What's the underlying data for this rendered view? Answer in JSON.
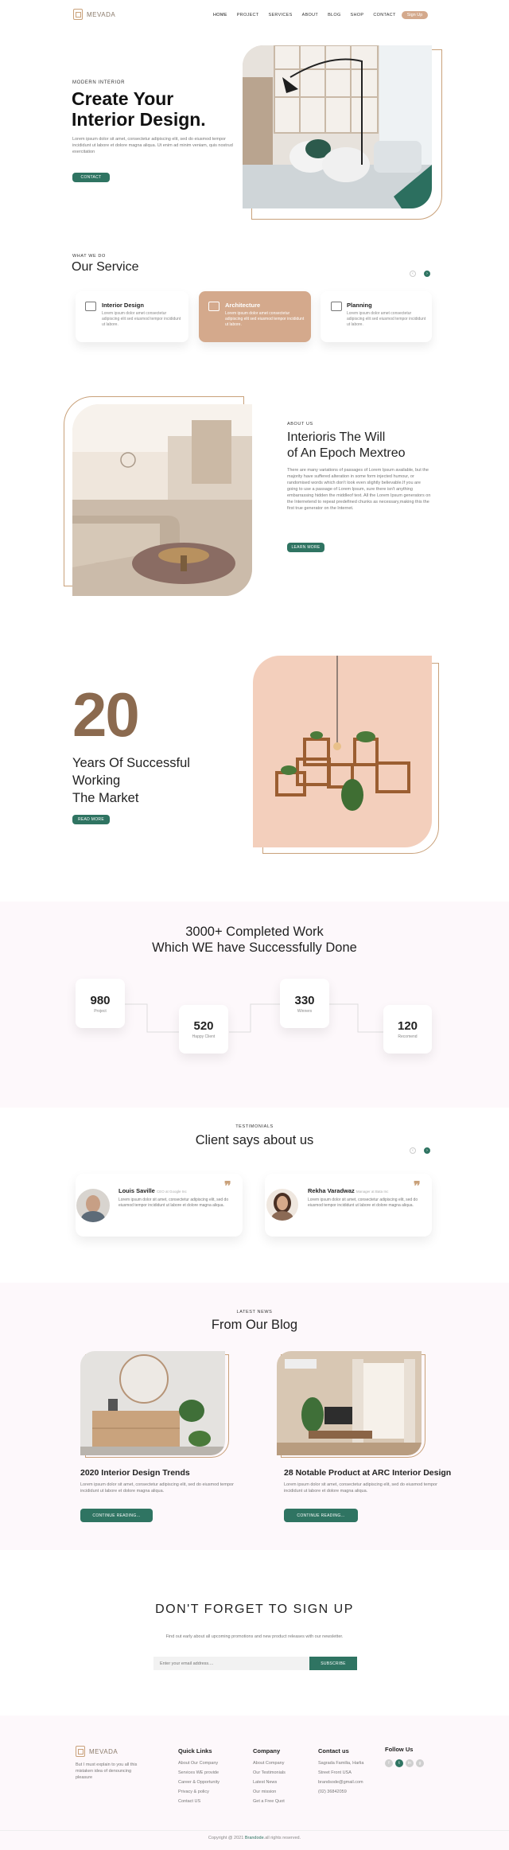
{
  "brand": {
    "name": "MEVADA"
  },
  "nav": {
    "items": [
      "HOME",
      "PROJECT",
      "SERVICES",
      "ABOUT",
      "BLOG",
      "SHOP",
      "CONTACT"
    ],
    "signup": "Sign Up"
  },
  "hero": {
    "kicker": "MODERN INTERIOR",
    "title_line1": "Create Your",
    "title_line2": "Interior Design.",
    "text": "Lorem ipsum dolor sit amet, consectetur adipiscing elit, sed do eiusmod tempor incididunt ut labore et dolore magna aliqua. Ut enim ad minim veniam, quis nostrud exercitation",
    "button": "CONTACT"
  },
  "services": {
    "kicker": "WHAT WE DO",
    "title": "Our Service",
    "items": [
      {
        "title": "Interior Design",
        "text": "Lorem ipsum dolor amet consectetur adipiscing elit sed eiusmod tempor incididunt ut labore."
      },
      {
        "title": "Architecture",
        "text": "Lorem ipsum dolor amet consectetur adipiscing elit sed eiusmod tempor incididunt ut labore."
      },
      {
        "title": "Planning",
        "text": "Lorem ipsum dolor amet consectetur adipiscing elit sed eiusmod tempor incididunt ut labore."
      }
    ]
  },
  "about": {
    "kicker": "ABOUT US",
    "title_line1": "Interioris The Will",
    "title_line2": "of An Epoch Mextreo",
    "text": "There are many variations of passages of Lorem Ipsum available, but the majority have suffered alteration in some form injected humour, or randomised words which don't look even slightly believable.If you are going to use a passage of Lorem Ipsum, sure there isn't anything embarrassing hidden the middleof text. All the Lorem Ipsum generators on the Internetend to repeat predefined chunks as necessary,making this the first true generator on the Internet.",
    "button": "LEARN MORE"
  },
  "years": {
    "number": "20",
    "line1": "Years Of Successful",
    "line2": "Working",
    "line3": "The Market",
    "button": "READ MORE"
  },
  "completed": {
    "title_line1": "3000+ Completed Work",
    "title_line2": "Which WE have Successfully Done",
    "stats": [
      {
        "value": "980",
        "label": "Project"
      },
      {
        "value": "520",
        "label": "Happy Client"
      },
      {
        "value": "330",
        "label": "Winners"
      },
      {
        "value": "120",
        "label": "Recomend"
      }
    ]
  },
  "testimonials": {
    "kicker": "TESTIMONIALS",
    "title": "Client says about us",
    "items": [
      {
        "name": "Louis Saville",
        "role": "CEO at Google Inc",
        "text": "Lorem ipsum dolor sit amet, consectetur adipiscing elit, sed do eiusmod tempor incididunt ut labore et dolore magna aliqua."
      },
      {
        "name": "Rekha Varadwaz",
        "role": "Manager at Bata Inc",
        "text": "Lorem ipsum dolor sit amet, consectetur adipiscing elit, sed do eiusmod tempor incididunt ut labore et dolore magna aliqua."
      }
    ]
  },
  "blog": {
    "kicker": "LATEST NEWS",
    "title": "From Our Blog",
    "posts": [
      {
        "title": "2020 Interior Design Trends",
        "text": "Lorem ipsum dolor sit amet, consectetur adipiscing elit, sed do eiusmod tempor incididunt ut labore et dolore magna aliqua.",
        "button": "CONTINUE READING..."
      },
      {
        "title": "28 Notable Product at ARC Interior Design",
        "text": "Lorem ipsum dolor sit amet, consectetur adipiscing elit, sed do eiusmod tempor incididunt ut labore et dolore magna aliqua.",
        "button": "CONTINUE READING..."
      }
    ]
  },
  "signup": {
    "title": "DON'T FORGET TO SIGN UP",
    "text": "Find out early about all upcoming promotions and new product releases with our newsletter.",
    "placeholder": "Enter your email address....",
    "button": "SUBSCRIBE"
  },
  "footer": {
    "about": "But I must explain to you all this mistaken idea of denouncing pleasure",
    "quick_title": "Quick Links",
    "quick": [
      "About Our Company",
      "Services WE provide",
      "Career & Opportunity",
      "Privacy & policy",
      "Contact US"
    ],
    "company_title": "Company",
    "company": [
      "About Company",
      "Our Testimonials",
      "Latest News",
      "Our mission",
      "Get a Free Quot"
    ],
    "contact_title": "Contact us",
    "contact": [
      "Sagrada Familia, Harlia",
      "Street Front USA",
      "brandsode@gmail.com",
      "(02) 36842059"
    ],
    "follow_title": "Follow Us",
    "social": [
      "f",
      "t",
      "in",
      "g"
    ],
    "copyright_pre": "Copyright @ 2021 ",
    "copyright_brand": "Brandode",
    "copyright_post": ".all rights reserved."
  },
  "colors": {
    "accent": "#2f7462",
    "tan": "#d4a98c",
    "bronze": "#c9a17a",
    "tint": "#fdf8fb"
  }
}
